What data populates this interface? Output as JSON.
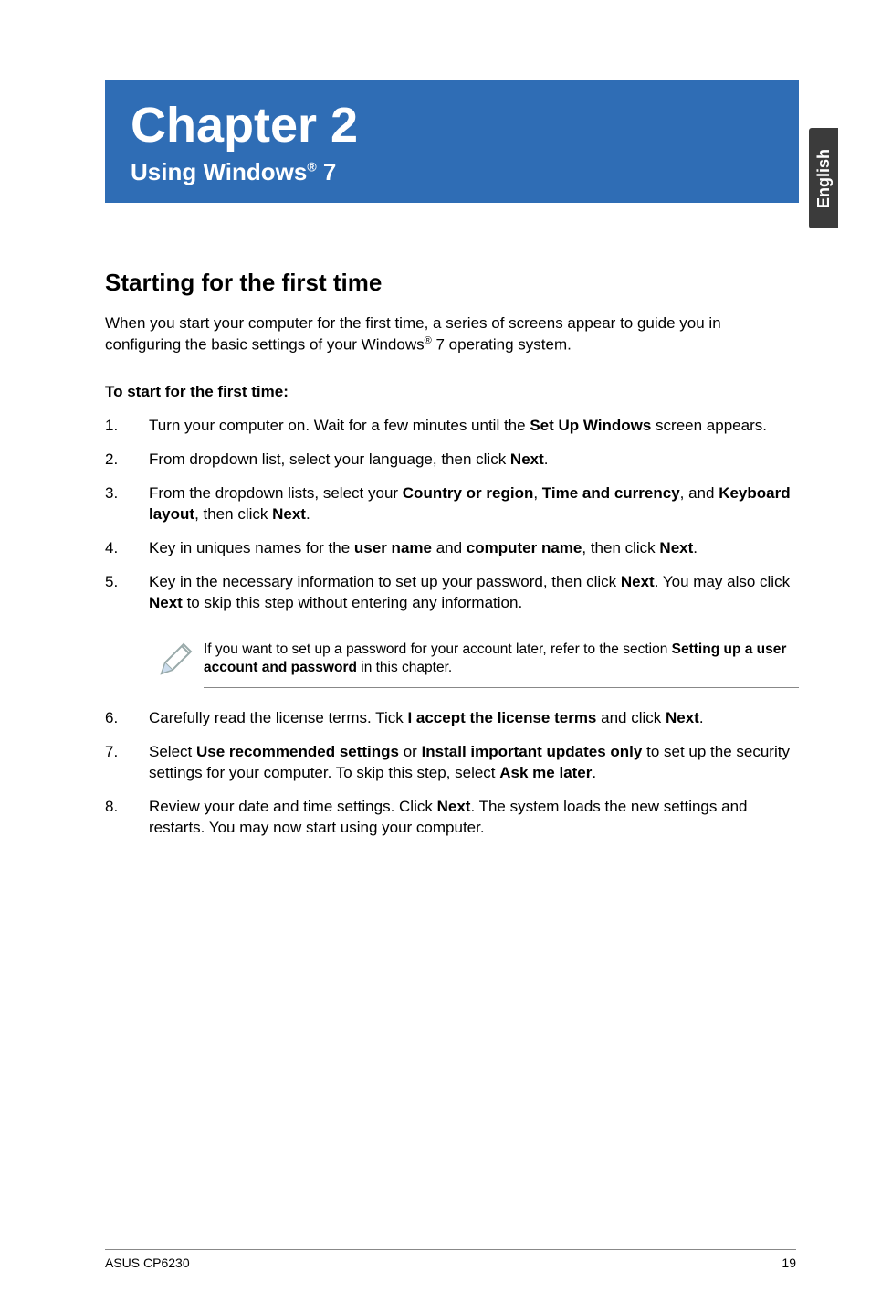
{
  "sidetab": {
    "label": "English"
  },
  "chapter": {
    "title": "Chapter 2",
    "subtitle_prefix": "Using Windows",
    "subtitle_sup": "®",
    "subtitle_suffix": " 7"
  },
  "section": {
    "heading": "Starting for the first time",
    "intro_a": "When you start your computer for the first time, a series of screens appear to guide you in configuring the basic settings of your Windows",
    "intro_sup": "®",
    "intro_b": " 7 operating system.",
    "subhead": "To start for the first time:"
  },
  "steps1": [
    {
      "n": "1.",
      "pre": "Turn your computer on. Wait for a few minutes until the ",
      "b1": "Set Up Windows",
      "post": " screen appears."
    },
    {
      "n": "2.",
      "pre": "From dropdown list, select your language, then click ",
      "b1": "Next",
      "post": "."
    },
    {
      "n": "3.",
      "pre": "From the dropdown lists, select your ",
      "b1": "Country or region",
      "mid1": ", ",
      "b2": "Time and currency",
      "mid2": ", and ",
      "b3": "Keyboard layout",
      "mid3": ", then click ",
      "b4": "Next",
      "post": "."
    },
    {
      "n": "4.",
      "pre": "Key in uniques names for the ",
      "b1": "user name",
      "mid1": " and ",
      "b2": "computer name",
      "mid2": ", then click ",
      "b3": "Next",
      "post": "."
    },
    {
      "n": "5.",
      "pre": "Key in the necessary information to set up your password, then click ",
      "b1": "Next",
      "mid1": ". You may also click ",
      "b2": "Next",
      "post": " to skip this step without entering any information."
    }
  ],
  "note": {
    "pre": "If you want to set up a password for your account later, refer to the section ",
    "b1": "Setting up a user account and password",
    "post": " in this chapter."
  },
  "steps2": [
    {
      "n": "6.",
      "pre": "Carefully read the license terms. Tick ",
      "b1": "I accept the license terms",
      "mid1": " and click ",
      "b2": "Next",
      "post": "."
    },
    {
      "n": "7.",
      "pre": "Select ",
      "b1": "Use recommended settings",
      "mid1": " or ",
      "b2": "Install important updates only",
      "mid2": " to set up the security settings for your computer. To skip this step, select ",
      "b3": "Ask me later",
      "post": "."
    },
    {
      "n": "8.",
      "pre": "Review your date and time settings. Click ",
      "b1": "Next",
      "post": ". The system loads the new settings and restarts. You may now start using your computer."
    }
  ],
  "footer": {
    "left": "ASUS CP6230",
    "right": "19"
  }
}
